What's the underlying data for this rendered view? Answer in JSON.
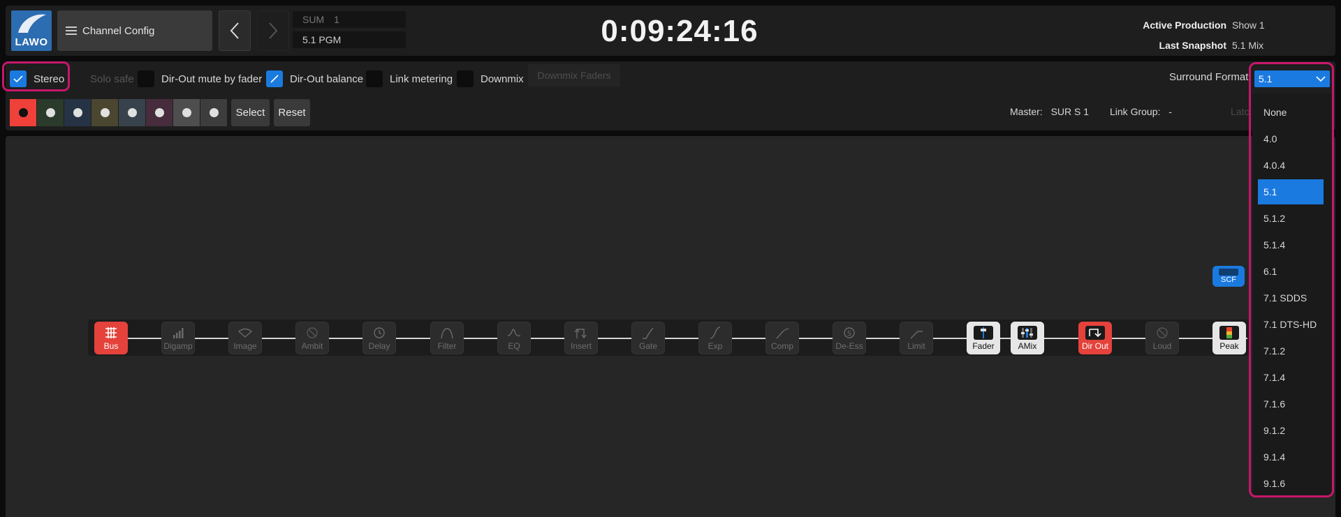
{
  "header": {
    "logo_text": "LAWO",
    "menu_label": "Channel Config",
    "channel_type": "SUM",
    "channel_number": "1",
    "channel_name": "5.1 PGM",
    "clock": "0:09:24:16",
    "active_production_label": "Active Production",
    "active_production_value": "Show 1",
    "last_snapshot_label": "Last Snapshot",
    "last_snapshot_value": "5.1 Mix"
  },
  "options": {
    "stereo": {
      "label": "Stereo",
      "checked": true
    },
    "solo_safe": {
      "label": "Solo safe",
      "disabled": true
    },
    "dir_out_mute": {
      "label": "Dir-Out mute by fader",
      "checked": false
    },
    "dir_out_balance": {
      "label": "Dir-Out balance",
      "checked": true
    },
    "link_metering": {
      "label": "Link metering",
      "checked": false
    },
    "downmix": {
      "label": "Downmix",
      "checked": false
    },
    "downmix_faders": "Downmix Faders",
    "surround_format_label": "Surround Format:"
  },
  "colors": {
    "swatches": [
      "#f0403a",
      "#2a3b2c",
      "#263345",
      "#4a4630",
      "#37424c",
      "#462c3c",
      "#4e4e4e",
      "#3d3d3d"
    ],
    "accent": "#1b7ae0",
    "highlight": "#c8176b"
  },
  "buttons": {
    "select": "Select",
    "reset": "Reset"
  },
  "meta": {
    "master_label": "Master:",
    "master_value": "SUR S  1",
    "link_group_label": "Link Group:",
    "link_group_value": "-",
    "latch_label": "Latc"
  },
  "surround": {
    "selected": "5.1",
    "options": [
      "None",
      "4.0",
      "4.0.4",
      "5.1",
      "5.1.2",
      "5.1.4",
      "6.1",
      "7.1 SDDS",
      "7.1 DTS-HD",
      "7.1.2",
      "7.1.4",
      "7.1.6",
      "9.1.2",
      "9.1.4",
      "9.1.6"
    ]
  },
  "chain": {
    "modules": [
      {
        "label": "Bus",
        "icon": "bus-icon",
        "state": "red"
      },
      {
        "label": "Digamp",
        "icon": "bars-icon",
        "state": "off"
      },
      {
        "label": "Image",
        "icon": "image-icon",
        "state": "off"
      },
      {
        "label": "Ambit",
        "icon": "disabled-icon",
        "state": "off"
      },
      {
        "label": "Delay",
        "icon": "clock-icon",
        "state": "off"
      },
      {
        "label": "Filter",
        "icon": "filter-icon",
        "state": "off"
      },
      {
        "label": "EQ",
        "icon": "eq-icon",
        "state": "off"
      },
      {
        "label": "Insert",
        "icon": "insert-icon",
        "state": "off"
      },
      {
        "label": "Gate",
        "icon": "gate-icon",
        "state": "off"
      },
      {
        "label": "Exp",
        "icon": "exp-icon",
        "state": "off"
      },
      {
        "label": "Comp",
        "icon": "comp-icon",
        "state": "off"
      },
      {
        "label": "De-Ess",
        "icon": "deess-icon",
        "state": "off"
      },
      {
        "label": "Limit",
        "icon": "limit-icon",
        "state": "off"
      },
      {
        "label": "Fader",
        "icon": "fader-icon",
        "state": "active"
      },
      {
        "label": "AMix",
        "icon": "amix-icon",
        "state": "active"
      },
      {
        "label": "Dir Out",
        "icon": "dirout-icon",
        "state": "red"
      },
      {
        "label": "Loud",
        "icon": "disabled-icon",
        "state": "off"
      },
      {
        "label": "Peak",
        "icon": "peak-icon",
        "state": "active"
      }
    ],
    "scf_label": "SCF"
  }
}
